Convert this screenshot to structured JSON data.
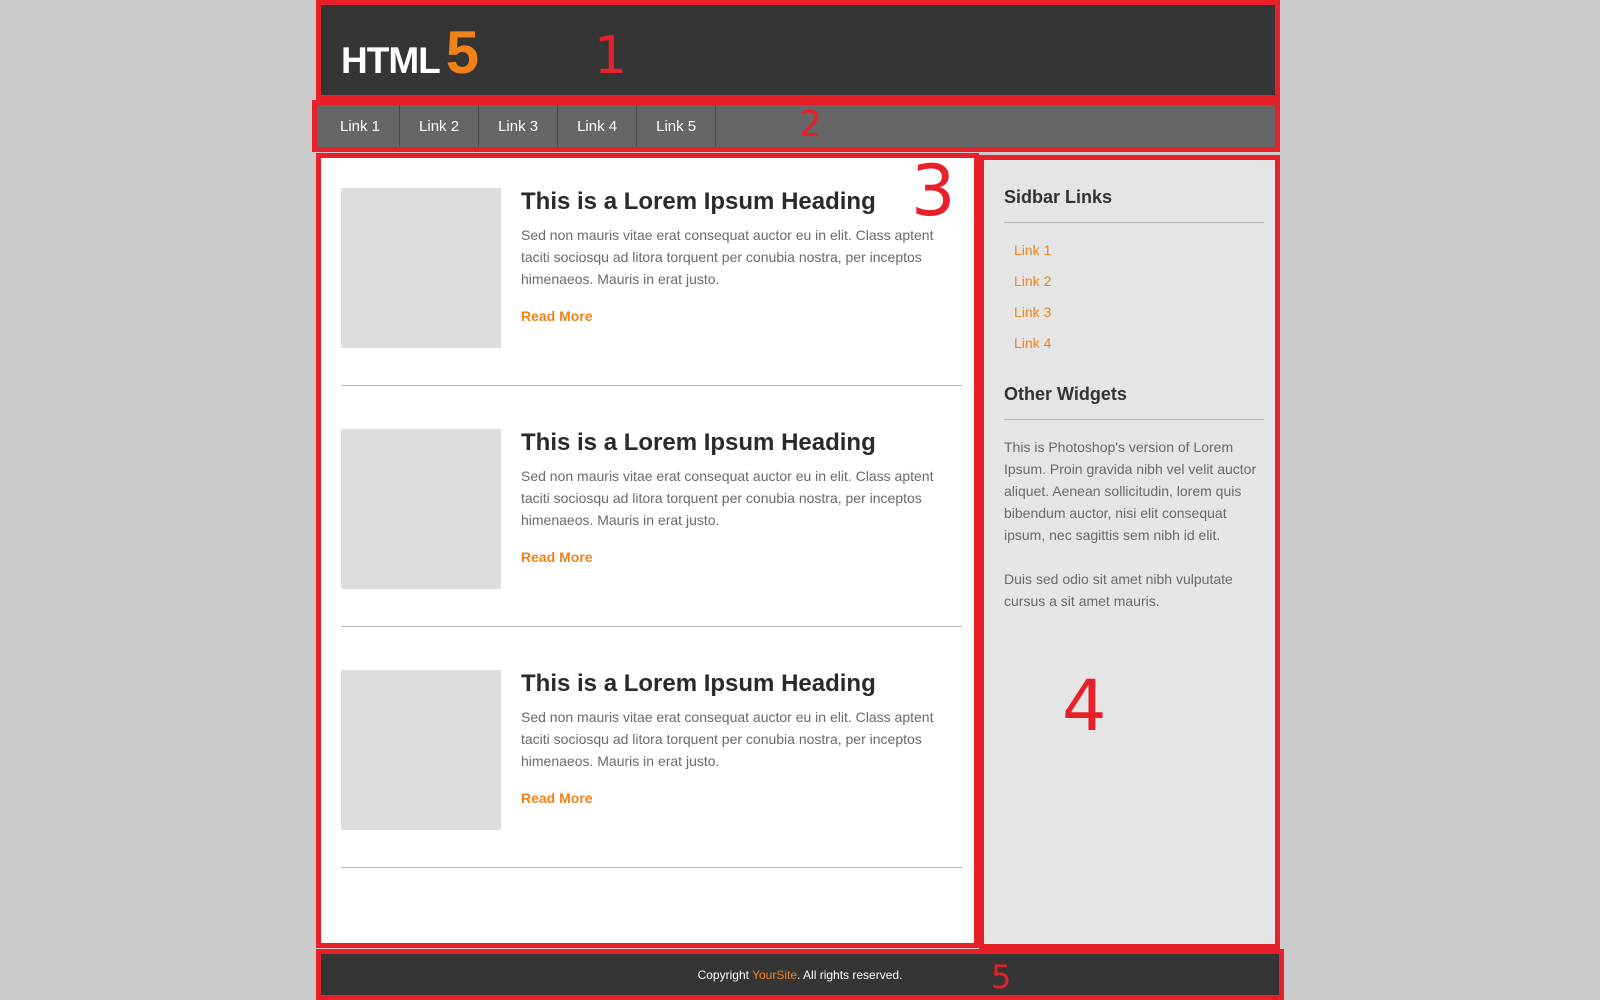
{
  "header": {
    "logo_text": "HTML",
    "logo_number": "5"
  },
  "nav": {
    "items": [
      "Link 1",
      "Link 2",
      "Link 3",
      "Link 4",
      "Link 5"
    ]
  },
  "articles": [
    {
      "title": "This is a Lorem Ipsum  Heading",
      "text": "Sed non  mauris vitae erat consequat auctor eu in elit. Class aptent taciti sociosqu ad litora torquent per conubia nostra, per inceptos himenaeos. Mauris in erat justo.",
      "read_more": "Read More"
    },
    {
      "title": "This is a Lorem Ipsum  Heading",
      "text": "Sed non  mauris vitae erat consequat auctor eu in elit. Class aptent taciti sociosqu ad litora torquent per conubia nostra, per inceptos himenaeos. Mauris in erat justo.",
      "read_more": "Read More"
    },
    {
      "title": "This is a Lorem Ipsum  Heading",
      "text": "Sed non  mauris vitae erat consequat auctor eu in elit. Class aptent taciti sociosqu ad litora torquent per conubia nostra, per inceptos himenaeos. Mauris in erat justo.",
      "read_more": "Read More"
    }
  ],
  "sidebar": {
    "links_heading": "Sidbar Links",
    "links": [
      "Link 1",
      "Link 2",
      "Link 3",
      "Link 4"
    ],
    "widgets_heading": "Other Widgets",
    "widget_text_1": "This is Photoshop's version  of Lorem Ipsum. Proin gravida nibh vel velit auctor aliquet. Aenean sollicitudin, lorem quis bibendum auctor, nisi elit consequat ipsum, nec sagittis sem nibh id elit.",
    "widget_text_2": "Duis sed odio sit amet nibh vulputate cursus a sit amet mauris."
  },
  "footer": {
    "prefix": "Copyright ",
    "site": "YourSite",
    "suffix": ". All rights reserved."
  },
  "markers": [
    "1",
    "2",
    "3",
    "4",
    "5"
  ],
  "colors": {
    "accent": "#f08219",
    "region_outline": "#e8202a",
    "header_bg": "#353535",
    "nav_bg": "#666666",
    "sidebar_bg": "#e5e5e5",
    "page_bg": "#cbcbcb"
  }
}
